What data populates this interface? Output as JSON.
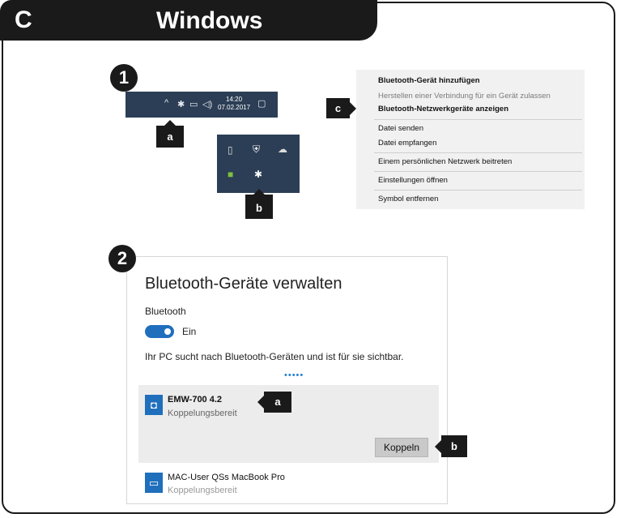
{
  "header": {
    "section_letter": "C",
    "title": "Windows"
  },
  "steps": {
    "one": "1",
    "two": "2"
  },
  "callouts": {
    "a": "a",
    "b": "b",
    "c": "c"
  },
  "taskbar": {
    "time": "14:20",
    "date": "07.02.2017",
    "icons": [
      "chevron-up-icon",
      "bluetooth-icon",
      "network-icon",
      "volume-icon",
      "notification-icon"
    ]
  },
  "tray": {
    "icons": [
      "usb-drive-icon",
      "shield-icon",
      "cloud-icon",
      "gpu-icon",
      "bluetooth-icon"
    ]
  },
  "context_menu": {
    "items": [
      {
        "label": "Bluetooth-Gerät hinzufügen",
        "style": "bold"
      },
      {
        "label": "Herstellen einer Verbindung für ein Gerät zulassen",
        "style": "dim"
      },
      {
        "label": "Bluetooth-Netzwerkgeräte anzeigen",
        "style": "bold"
      },
      {
        "label": "Datei senden",
        "style": "normal"
      },
      {
        "label": "Datei empfangen",
        "style": "normal"
      },
      {
        "label": "Einem persönlichen Netzwerk beitreten",
        "style": "normal"
      },
      {
        "label": "Einstellungen öffnen",
        "style": "normal"
      },
      {
        "label": "Symbol entfernen",
        "style": "normal"
      }
    ]
  },
  "bluetooth_panel": {
    "title": "Bluetooth-Geräte verwalten",
    "bluetooth_label": "Bluetooth",
    "toggle_state": "Ein",
    "search_text": "Ihr PC sucht nach Bluetooth-Geräten und ist für sie sichtbar.",
    "progress_dots": "•••••",
    "devices": [
      {
        "name": "EMW-700 4.2",
        "status": "Koppelungsbereit",
        "icon": "mouse-icon"
      },
      {
        "name": "MAC-User QSs MacBook Pro",
        "status": "Koppelungsbereit",
        "icon": "computer-icon"
      }
    ],
    "pair_button": "Koppeln"
  },
  "colors": {
    "dark": "#1a1a1a",
    "taskbar": "#2c3e55",
    "accent": "#1f6fbd",
    "menu_bg": "#f1f1f1"
  }
}
